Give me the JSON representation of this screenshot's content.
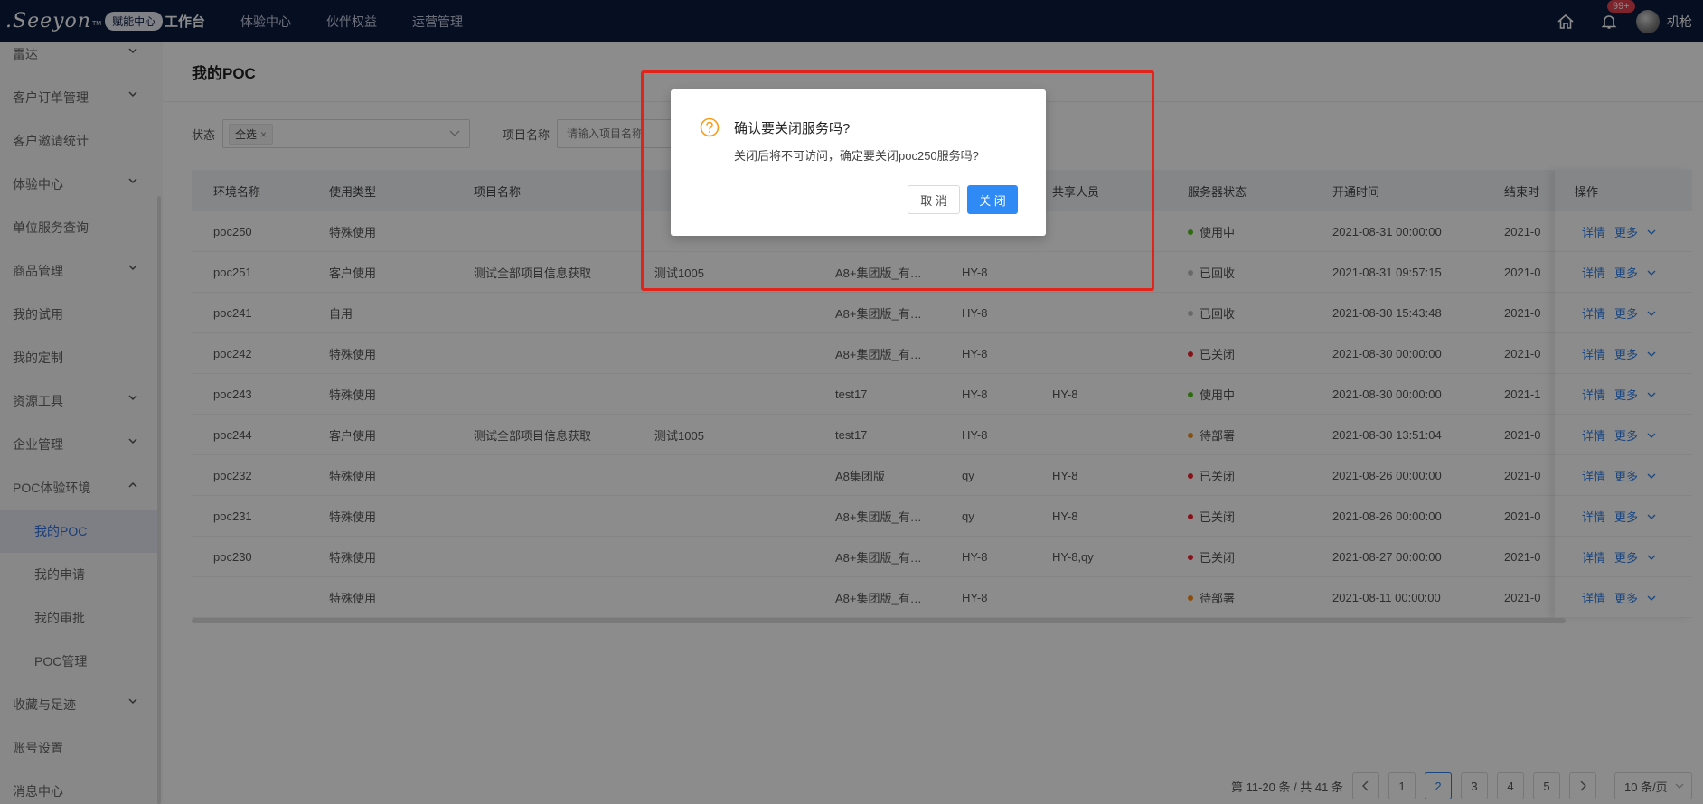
{
  "header": {
    "logo_text": ".Seeyon",
    "logo_tm": "TM",
    "logo_badge": "赋能中心",
    "nav": [
      "工作台",
      "体验中心",
      "伙伴权益",
      "运营管理"
    ],
    "notify_count": "99+",
    "username": "机枪"
  },
  "sidebar": {
    "items": [
      {
        "label": "雷达",
        "arrow": "down"
      },
      {
        "label": "客户订单管理",
        "arrow": "down"
      },
      {
        "label": "客户邀请统计"
      },
      {
        "label": "体验中心",
        "arrow": "down"
      },
      {
        "label": "单位服务查询"
      },
      {
        "label": "商品管理",
        "arrow": "down"
      },
      {
        "label": "我的试用"
      },
      {
        "label": "我的定制"
      },
      {
        "label": "资源工具",
        "arrow": "down"
      },
      {
        "label": "企业管理",
        "arrow": "down"
      },
      {
        "label": "POC体验环境",
        "arrow": "up"
      },
      {
        "label": "我的POC",
        "child": true,
        "active": true
      },
      {
        "label": "我的申请",
        "child": true
      },
      {
        "label": "我的审批",
        "child": true
      },
      {
        "label": "POC管理",
        "child": true
      },
      {
        "label": "收藏与足迹",
        "arrow": "down"
      },
      {
        "label": "账号设置"
      },
      {
        "label": "消息中心"
      }
    ]
  },
  "page": {
    "title": "我的POC",
    "filter_status_label": "状态",
    "filter_status_tag": "全选",
    "filter_project_label": "项目名称",
    "filter_project_placeholder": "请输入项目名称"
  },
  "table": {
    "columns": [
      "环境名称",
      "使用类型",
      "项目名称",
      "",
      "",
      "",
      "共享人员",
      "服务器状态",
      "开通时间",
      "结束时"
    ],
    "op_header": "操作",
    "rows": [
      [
        "poc250",
        "特殊使用",
        "",
        "",
        "",
        "",
        "",
        "使用中",
        "2021-08-31 00:00:00",
        "2021-0"
      ],
      [
        "poc251",
        "客户使用",
        "测试全部项目信息获取",
        "测试1005",
        "A8+集团版_有…",
        "HY-8",
        "",
        "已回收",
        "2021-08-31 09:57:15",
        "2021-0"
      ],
      [
        "poc241",
        "自用",
        "",
        "",
        "A8+集团版_有…",
        "HY-8",
        "",
        "已回收",
        "2021-08-30 15:43:48",
        "2021-0"
      ],
      [
        "poc242",
        "特殊使用",
        "",
        "",
        "A8+集团版_有…",
        "HY-8",
        "",
        "已关闭",
        "2021-08-30 00:00:00",
        "2021-0"
      ],
      [
        "poc243",
        "特殊使用",
        "",
        "",
        "test17",
        "HY-8",
        "HY-8",
        "使用中",
        "2021-08-30 00:00:00",
        "2021-1"
      ],
      [
        "poc244",
        "客户使用",
        "测试全部项目信息获取",
        "测试1005",
        "test17",
        "HY-8",
        "",
        "待部署",
        "2021-08-30 13:51:04",
        "2021-0"
      ],
      [
        "poc232",
        "特殊使用",
        "",
        "",
        "A8集团版",
        "qy",
        "HY-8",
        "已关闭",
        "2021-08-26 00:00:00",
        "2021-0"
      ],
      [
        "poc231",
        "特殊使用",
        "",
        "",
        "A8+集团版_有…",
        "qy",
        "HY-8",
        "已关闭",
        "2021-08-26 00:00:00",
        "2021-0"
      ],
      [
        "poc230",
        "特殊使用",
        "",
        "",
        "A8+集团版_有…",
        "HY-8",
        "HY-8,qy",
        "已关闭",
        "2021-08-27 00:00:00",
        "2021-0"
      ],
      [
        "",
        "特殊使用",
        "",
        "",
        "A8+集团版_有…",
        "HY-8",
        "",
        "待部署",
        "2021-08-11 00:00:00",
        "2021-0"
      ]
    ],
    "status_colors": {
      "使用中": "#52c41a",
      "已回收": "#bfbfbf",
      "已关闭": "#f5222d",
      "待部署": "#fa8c16"
    },
    "op_detail": "详情",
    "op_more": "更多"
  },
  "pagination": {
    "total_text": "第 11-20 条 / 共 41 条",
    "pages": [
      "1",
      "2",
      "3",
      "4",
      "5"
    ],
    "current": "2",
    "page_size": "10 条/页"
  },
  "dialog": {
    "title": "确认要关闭服务吗?",
    "message": "关闭后将不可访问，确定要关闭poc250服务吗?",
    "cancel_label": "取 消",
    "ok_label": "关 闭"
  }
}
